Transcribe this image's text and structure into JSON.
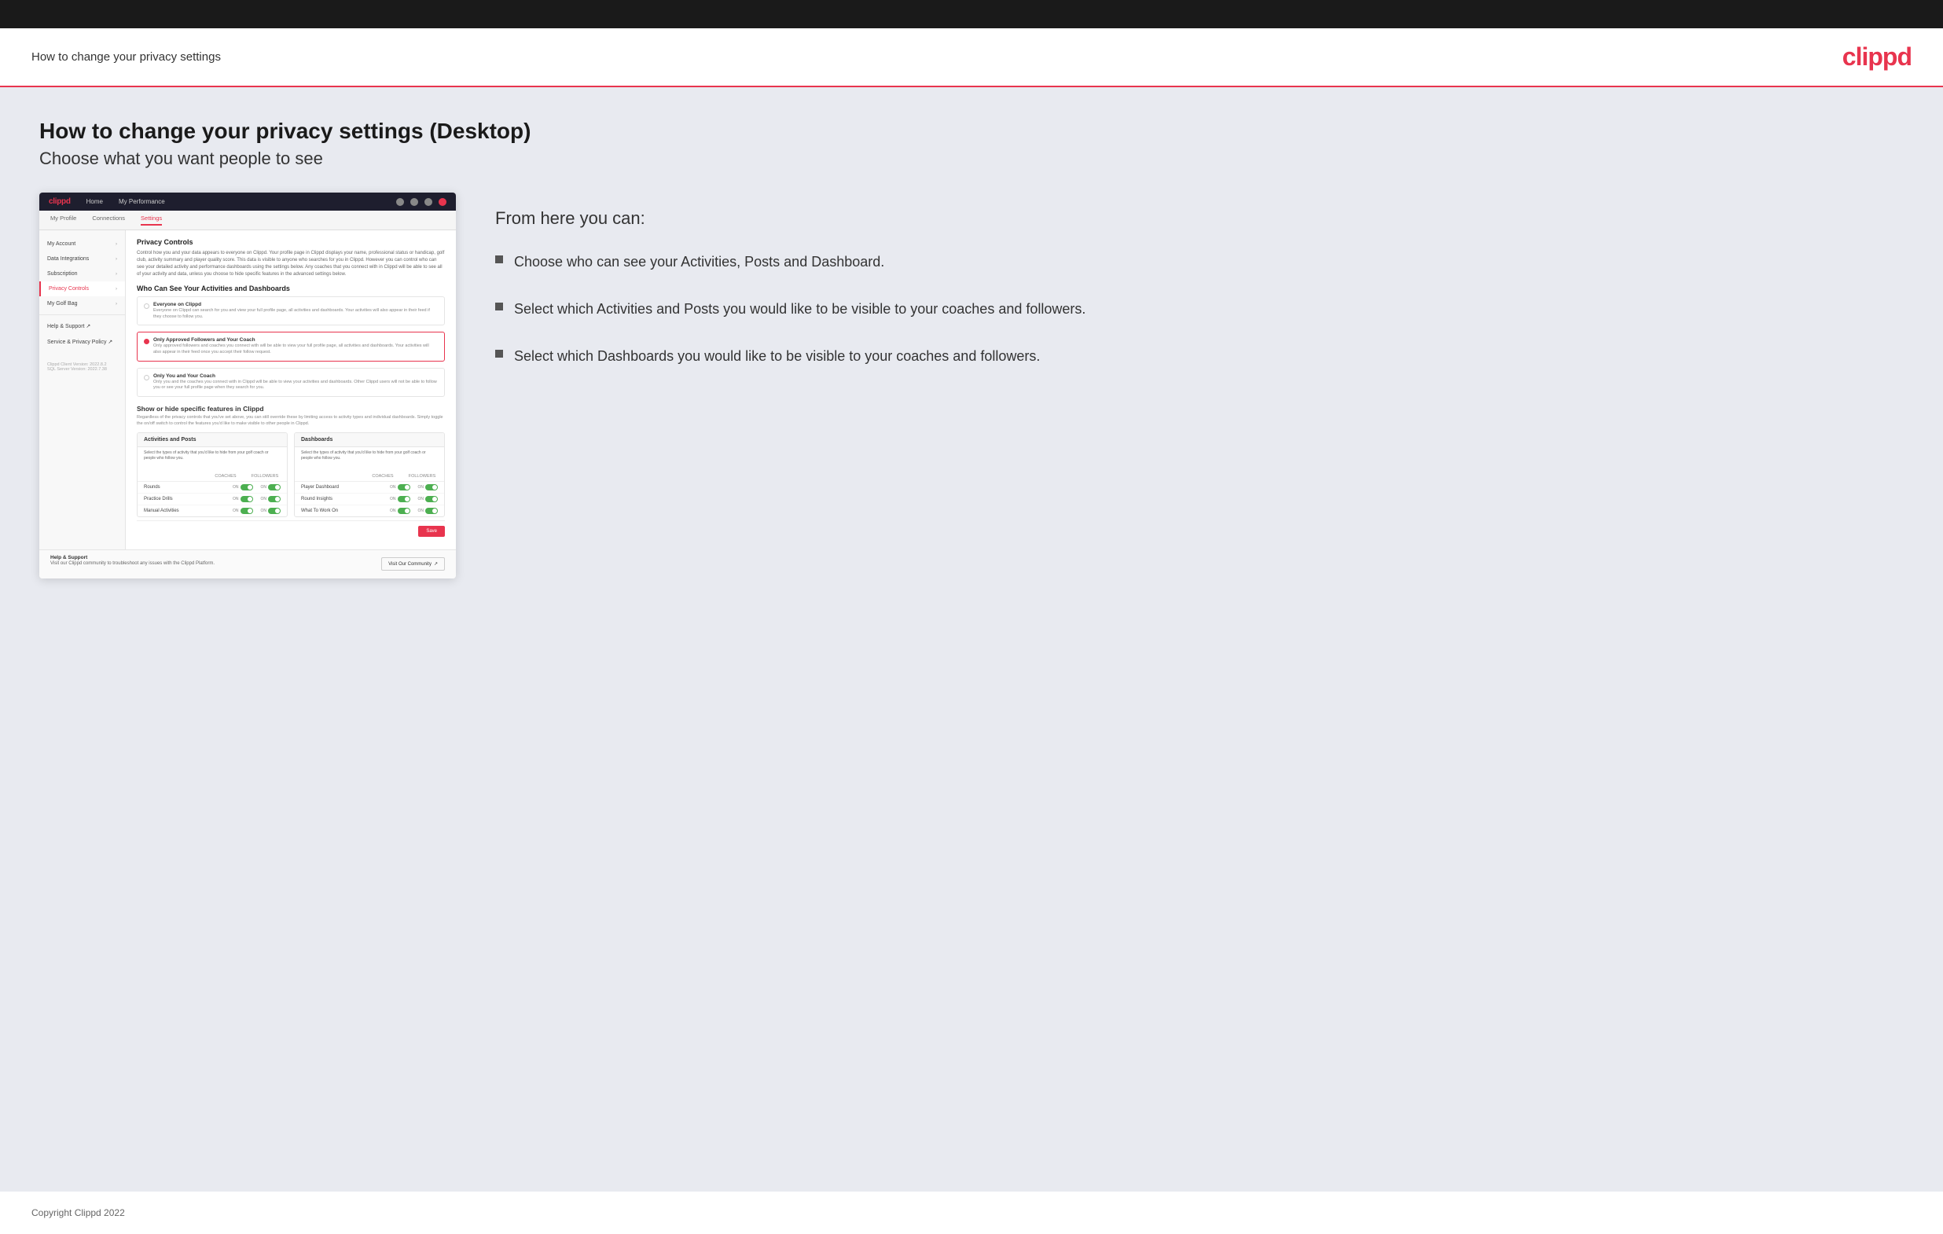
{
  "header": {
    "title": "How to change your privacy settings",
    "logo": "clippd"
  },
  "page": {
    "heading": "How to change your privacy settings (Desktop)",
    "subheading": "Choose what you want people to see"
  },
  "from_here": {
    "title": "From here you can:",
    "bullets": [
      "Choose who can see your Activities, Posts and Dashboard.",
      "Select which Activities and Posts you would like to be visible to your coaches and followers.",
      "Select which Dashboards you would like to be visible to your coaches and followers."
    ]
  },
  "mock_nav": {
    "logo": "clippd",
    "items": [
      "Home",
      "My Performance"
    ]
  },
  "mock_subnav": {
    "items": [
      "My Profile",
      "Connections",
      "Settings"
    ]
  },
  "mock_sidebar": {
    "items": [
      {
        "label": "My Account",
        "active": false
      },
      {
        "label": "Data Integrations",
        "active": false
      },
      {
        "label": "Subscription",
        "active": false
      },
      {
        "label": "Privacy Controls",
        "active": true
      },
      {
        "label": "My Golf Bag",
        "active": false
      },
      {
        "label": "Help & Support",
        "active": false
      },
      {
        "label": "Service & Privacy Policy",
        "active": false
      }
    ],
    "version": "Clippd Client Version: 2022.8.2\nSQL Server Version: 2022.7.38"
  },
  "mock_panel": {
    "privacy_controls": {
      "title": "Privacy Controls",
      "description": "Control how you and your data appears to everyone on Clippd. Your profile page in Clippd displays your name, professional status or handicap, golf club, activity summary and player quality score. This data is visible to anyone who searches for you in Clippd. However you can control who can see your detailed activity and performance dashboards using the settings below. Any coaches that you connect with in Clippd will be able to see all of your activity and data, unless you choose to hide specific features in the advanced settings below."
    },
    "visibility_section": {
      "title": "Who Can See Your Activities and Dashboards",
      "options": [
        {
          "id": "everyone",
          "label": "Everyone on Clippd",
          "description": "Everyone on Clippd can search for you and view your full profile page, all activities and dashboards. Your activities will also appear in their feed if they choose to follow you.",
          "selected": false
        },
        {
          "id": "followers",
          "label": "Only Approved Followers and Your Coach",
          "description": "Only approved followers and coaches you connect with will be able to view your full profile page, all activities and dashboards. Your activities will also appear in their feed once you accept their follow request.",
          "selected": true
        },
        {
          "id": "coach_only",
          "label": "Only You and Your Coach",
          "description": "Only you and the coaches you connect with in Clippd will be able to view your activities and dashboards. Other Clippd users will not be able to follow you or see your full profile page when they search for you.",
          "selected": false
        }
      ]
    },
    "features_section": {
      "title": "Show or hide specific features in Clippd",
      "description": "Regardless of the privacy controls that you've set above, you can still override these by limiting access to activity types and individual dashboards. Simply toggle the on/off switch to control the features you'd like to make visible to other people in Clippd.",
      "activities_posts": {
        "title": "Activities and Posts",
        "description": "Select the types of activity that you'd like to hide from your golf coach or people who follow you.",
        "columns": [
          "COACHES",
          "FOLLOWERS"
        ],
        "rows": [
          {
            "label": "Rounds",
            "coaches": true,
            "followers": true
          },
          {
            "label": "Practice Drills",
            "coaches": true,
            "followers": true
          },
          {
            "label": "Manual Activities",
            "coaches": true,
            "followers": true
          }
        ]
      },
      "dashboards": {
        "title": "Dashboards",
        "description": "Select the types of activity that you'd like to hide from your golf coach or people who follow you.",
        "columns": [
          "COACHES",
          "FOLLOWERS"
        ],
        "rows": [
          {
            "label": "Player Dashboard",
            "coaches": true,
            "followers": true
          },
          {
            "label": "Round Insights",
            "coaches": true,
            "followers": true
          },
          {
            "label": "What To Work On",
            "coaches": true,
            "followers": true
          }
        ]
      }
    },
    "save_button": "Save",
    "help": {
      "title": "Help & Support",
      "description": "Visit our Clippd community to troubleshoot any issues with the Clippd Platform.",
      "button": "Visit Our Community"
    }
  },
  "footer": {
    "text": "Copyright Clippd 2022"
  }
}
